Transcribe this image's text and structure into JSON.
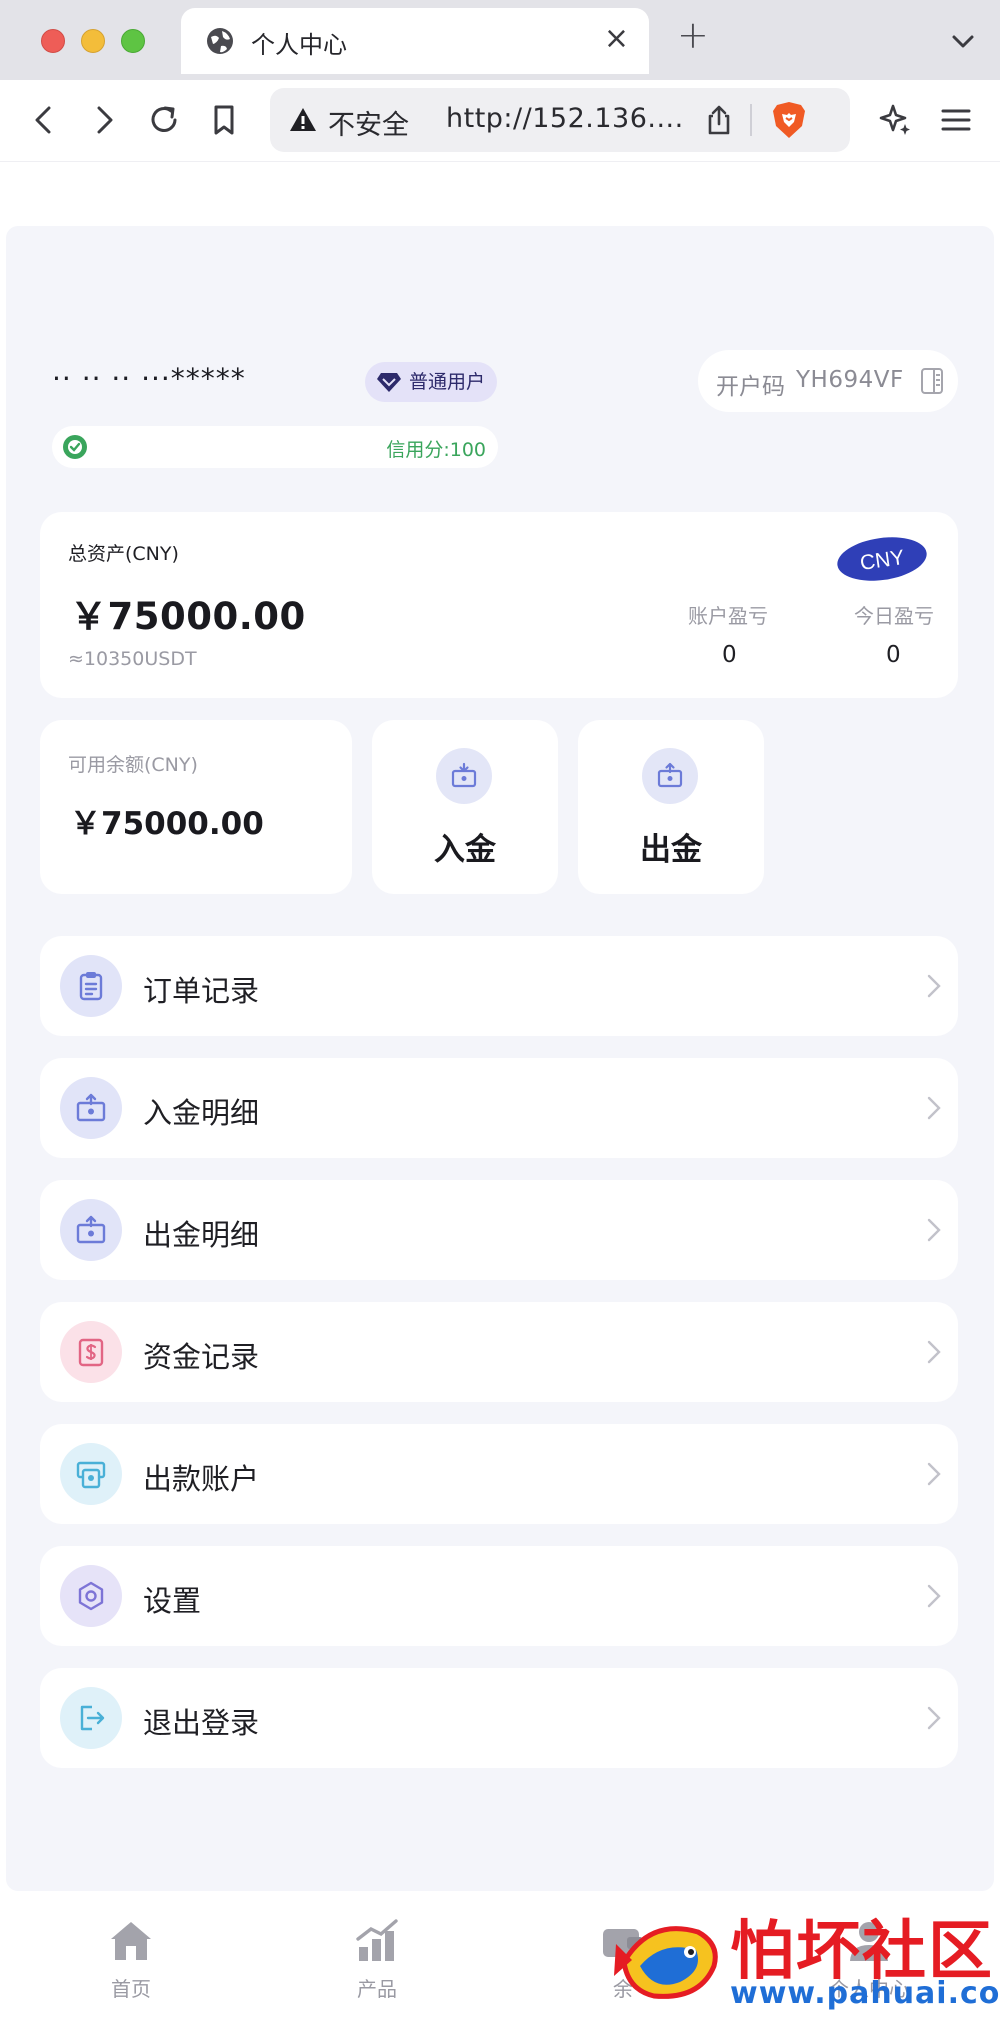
{
  "browser": {
    "tab_title": "个人中心",
    "tab_close": "×",
    "new_tab": "+",
    "security_label": "不安全",
    "url": "http://152.136...."
  },
  "profile": {
    "username": "·· ·· ·· ···*****",
    "role_badge": "普通用户",
    "account_code_label": "开户码",
    "account_code": "YH694VF",
    "credit_score": "信用分:100"
  },
  "assets": {
    "total_label": "总资产(CNY)",
    "total_amount": "￥75000.00",
    "usdt_equiv": "≈10350USDT",
    "currency_badge": "CNY",
    "account_pnl_label": "账户盈亏",
    "account_pnl_value": "0",
    "today_pnl_label": "今日盈亏",
    "today_pnl_value": "0"
  },
  "balance": {
    "label": "可用余额(CNY)",
    "amount": "￥75000.00"
  },
  "actions": [
    {
      "label": "入金",
      "icon": "deposit-icon"
    },
    {
      "label": "出金",
      "icon": "withdraw-icon"
    }
  ],
  "menu": [
    {
      "label": "订单记录",
      "icon": "order-record-icon",
      "color": "#6c7bd8"
    },
    {
      "label": "入金明细",
      "icon": "deposit-detail-icon",
      "color": "#6c7bd8"
    },
    {
      "label": "出金明细",
      "icon": "withdraw-detail-icon",
      "color": "#6c7bd8"
    },
    {
      "label": "资金记录",
      "icon": "fund-record-icon",
      "color": "#e26584"
    },
    {
      "label": "出款账户",
      "icon": "payout-account-icon",
      "color": "#49b0d7"
    },
    {
      "label": "设置",
      "icon": "settings-icon",
      "color": "#7d74d6"
    },
    {
      "label": "退出登录",
      "icon": "logout-icon",
      "color": "#49b0d7"
    }
  ],
  "bottom_nav": [
    {
      "label": "首页",
      "icon": "home-icon"
    },
    {
      "label": "产品",
      "icon": "chart-icon"
    },
    {
      "label": "余",
      "icon": "wallet-icon"
    },
    {
      "label": "个人中心",
      "icon": "user-icon"
    }
  ],
  "watermark": {
    "title": "怕坏社区",
    "url": "www.pahuai.com"
  },
  "colors": {
    "accent": "#2f3fb7",
    "credit": "#3aa55c",
    "page_bg": "#f4f5fa"
  }
}
